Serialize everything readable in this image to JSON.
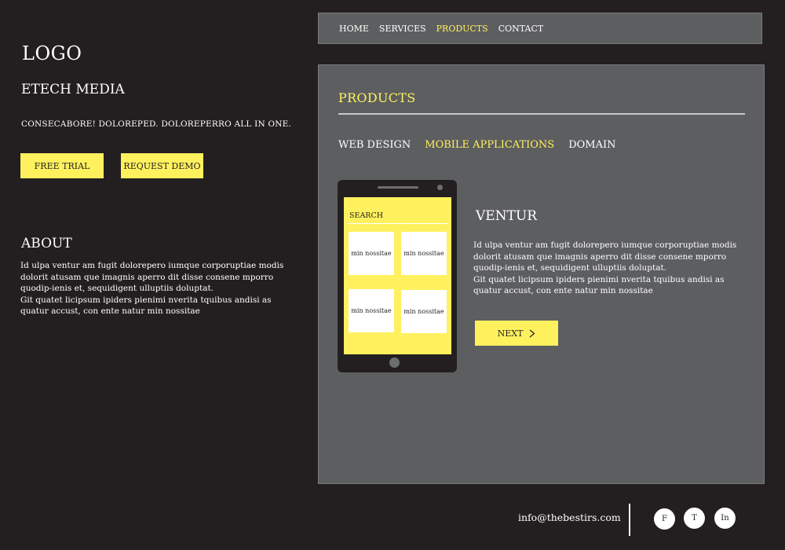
{
  "header": {
    "logo": "LOGO",
    "brand": "ETECH MEDIA",
    "tagline": "CONSECABORE!  DOLOREPED. DOLOREPERRO ALL IN ONE.",
    "free_trial_label": "FREE TRIAL",
    "request_demo_label": "REQUEST DEMO"
  },
  "about": {
    "title": "ABOUT",
    "paragraph1": "Id ulpa ventur am fugit dolorepero iumque corporuptiae modis dolorit atusam que imagnis aperro dit disse consene mporro quodip-ienis et, sequidigent ulluptiis doluptat.",
    "paragraph2": "Git quatet licipsum ipiders pienimi nverita tquibus andisi as quatur accust, con ente natur min nossitae"
  },
  "nav": {
    "items": [
      {
        "label": "HOME",
        "active": false
      },
      {
        "label": "SERVICES",
        "active": false
      },
      {
        "label": "PRODUCTS",
        "active": true
      },
      {
        "label": "CONTACT",
        "active": false
      }
    ]
  },
  "products": {
    "title": "PRODUCTS",
    "tabs": [
      {
        "label": "WEB DESIGN",
        "active": false
      },
      {
        "label": "MOBILE APPLICATIONS",
        "active": true
      },
      {
        "label": "DOMAIN",
        "active": false
      }
    ],
    "phone": {
      "search_label": "SEARCH",
      "cards": [
        "min nossitae",
        "min nossitae",
        "min nossitae",
        "min nossitae"
      ]
    },
    "venture_title": "VENTUR",
    "venture_paragraph1": "Id ulpa ventur am fugit dolorepero iumque corporuptiae modis dolorit atusam que imagnis aperro dit disse consene mporro quodip-ienis et, sequidigent ulluptiis doluptat.",
    "venture_paragraph2": "Git quatet licipsum ipiders pienimi nverita tquibus andisi as quatur accust, con ente natur min nossitae",
    "next_label": "NEXT"
  },
  "footer": {
    "email": "info@thebestirs.com",
    "social": [
      "F",
      "T",
      "In"
    ]
  },
  "colors": {
    "background": "#231f20",
    "panel": "#5d5e60",
    "accent": "#fff15e"
  }
}
